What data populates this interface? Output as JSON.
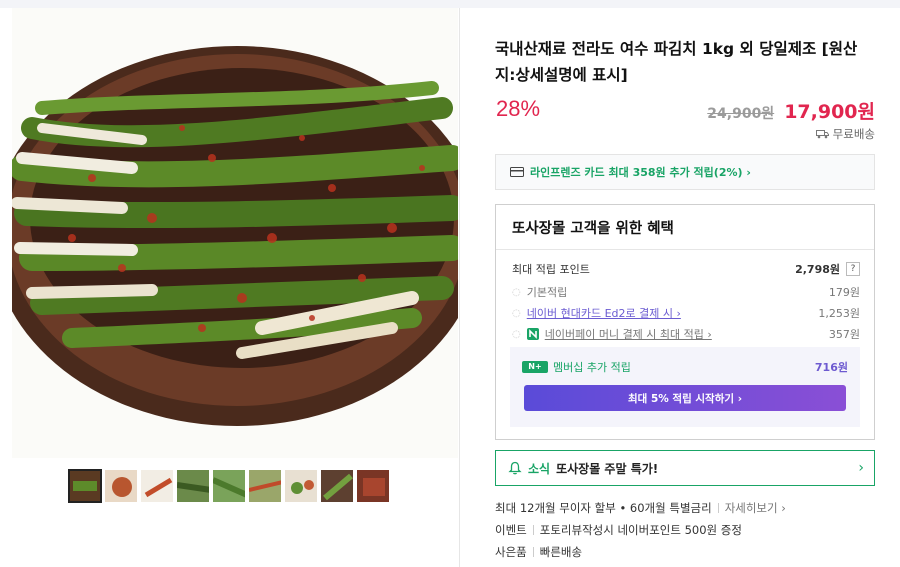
{
  "product": {
    "title": "국내산재료 전라도 여수 파김치 1kg 외 당일제조 [원산지:상세설명에 표시]",
    "discount": "28%",
    "original_price": "24,900원",
    "price": "17,900원",
    "shipping": "무료배송"
  },
  "card_promo": {
    "text": "라인프렌즈 카드 최대 358원 추가 적립(2%) ›"
  },
  "benefit": {
    "title": "또사장몰 고객을 위한 혜택",
    "max_points_label": "최대 적립 포인트",
    "max_points_value": "2,798원",
    "help": "?",
    "items": [
      {
        "label": "기본적립",
        "value": "179원"
      },
      {
        "label": "네이버 현대카드 Ed2로 결제 시 ›",
        "value": "1,253원"
      },
      {
        "label": "네이버페이 머니 결제 시 최대 적립 ›",
        "value": "357원"
      }
    ],
    "member": {
      "badge": "N+",
      "label": "멤버십 추가 적립",
      "value": "716원",
      "button": "최대 5% 적립 시작하기 ›"
    }
  },
  "news": {
    "tag": "소식",
    "text": "또사장몰 주말 특가!"
  },
  "info": {
    "installment": "최대 12개월 무이자 할부 • 60개월 특별금리",
    "more": "자세히보기 ›",
    "event_label": "이벤트",
    "event_text": "포토리뷰작성시 네이버포인트 500원 증정",
    "gift_label": "사은품",
    "gift_text": "빠른배송"
  },
  "thumbnails": [
    "thumb-1",
    "thumb-2",
    "thumb-3",
    "thumb-4",
    "thumb-5",
    "thumb-6",
    "thumb-7",
    "thumb-8",
    "thumb-9"
  ],
  "colors": {
    "accent": "#e1264f",
    "green": "#19a466",
    "purple": "#6d5ad0"
  }
}
